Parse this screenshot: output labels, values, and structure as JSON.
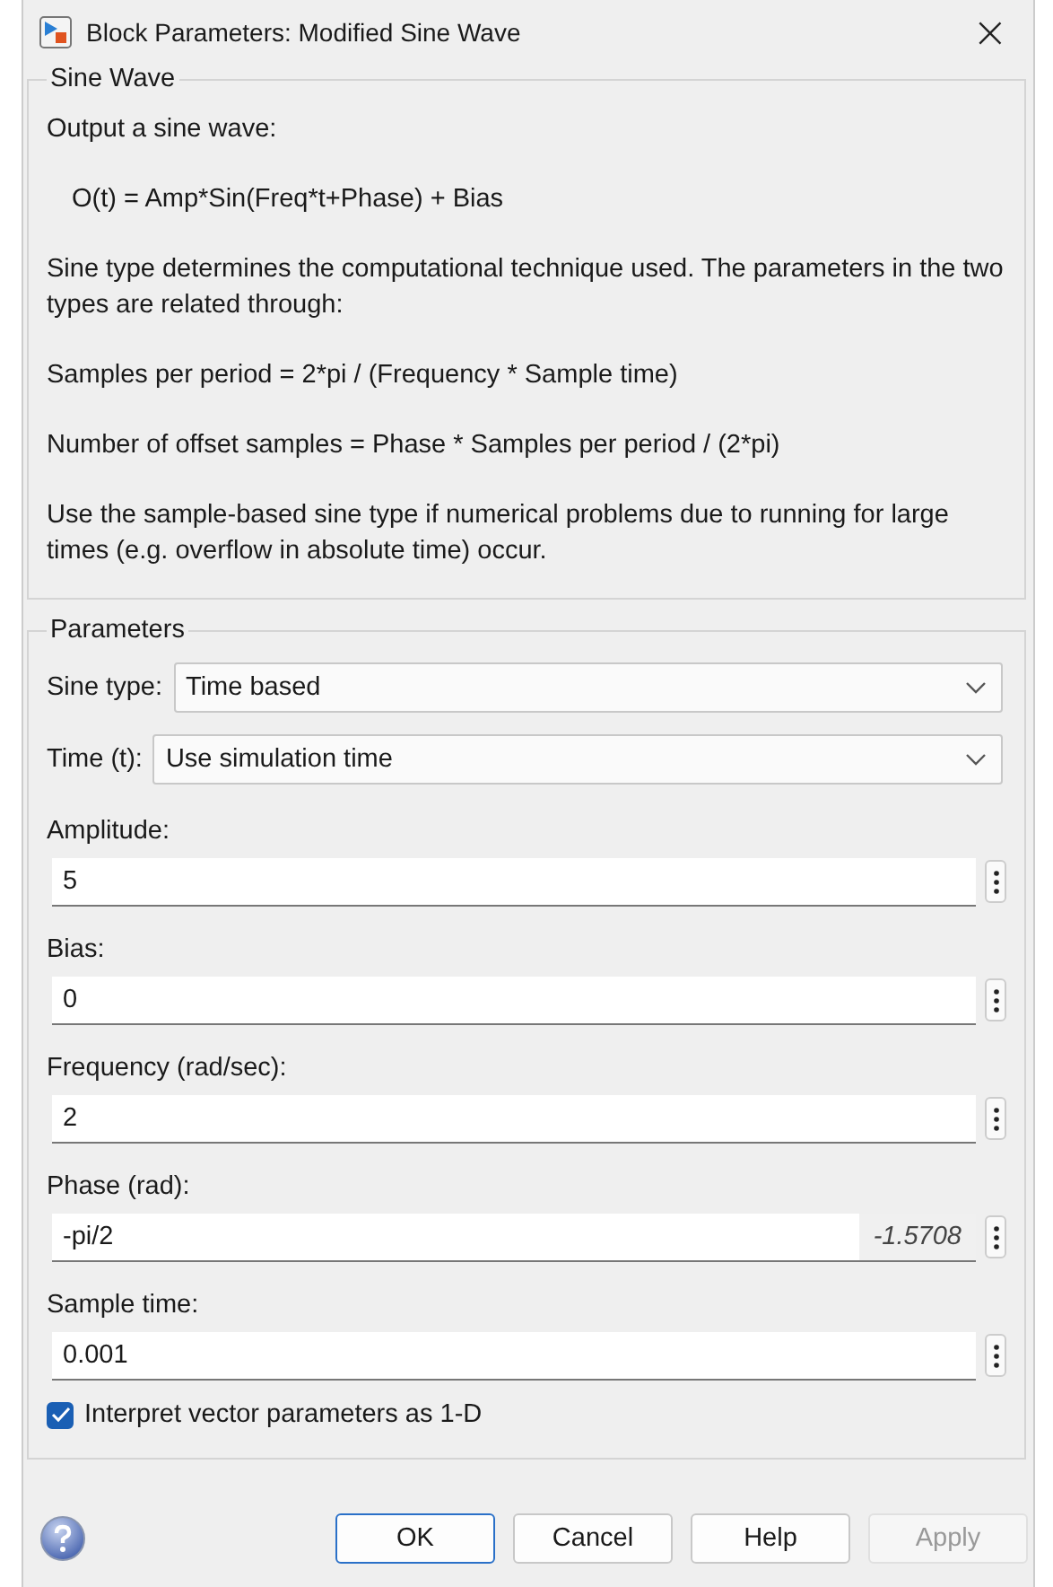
{
  "window": {
    "title": "Block Parameters: Modified Sine Wave",
    "close": "×"
  },
  "description_group": {
    "legend": "Sine Wave",
    "paragraphs": [
      {
        "kind": "text",
        "text": "Output a sine wave:"
      },
      {
        "kind": "formula",
        "text": "O(t) = Amp*Sin(Freq*t+Phase) + Bias"
      },
      {
        "kind": "text",
        "text": "Sine type determines the computational technique used. The parameters in the two types are related through:"
      },
      {
        "kind": "text",
        "text": "Samples per period = 2*pi / (Frequency * Sample time)"
      },
      {
        "kind": "text",
        "text": "Number of offset samples = Phase * Samples per period / (2*pi)"
      },
      {
        "kind": "text",
        "text": "Use the sample-based sine type if numerical problems due to running for large times (e.g. overflow in absolute time) occur."
      }
    ]
  },
  "parameters_group": {
    "legend": "Parameters",
    "fields": [
      {
        "kind": "dropdown",
        "label": "Sine type:",
        "value": "Time based"
      },
      {
        "kind": "dropdown",
        "label": "Time (t):",
        "value": "Use simulation time"
      },
      {
        "kind": "text",
        "label": "Amplitude:",
        "value": "5"
      },
      {
        "kind": "text",
        "label": "Bias:",
        "value": "0"
      },
      {
        "kind": "text",
        "label": "Frequency (rad/sec):",
        "value": "2"
      },
      {
        "kind": "text",
        "label": "Phase (rad):",
        "value": "-pi/2",
        "evaluated": "-1.5708"
      },
      {
        "kind": "text",
        "label": "Sample time:",
        "value": "0.001"
      }
    ],
    "checkbox": {
      "label": "Interpret vector parameters as 1-D",
      "checked": true
    }
  },
  "buttons": [
    {
      "label": "OK",
      "default": true,
      "disabled": false
    },
    {
      "label": "Cancel",
      "default": false,
      "disabled": false
    },
    {
      "label": "Help",
      "default": false,
      "disabled": false
    },
    {
      "label": "Apply",
      "default": false,
      "disabled": true
    }
  ]
}
